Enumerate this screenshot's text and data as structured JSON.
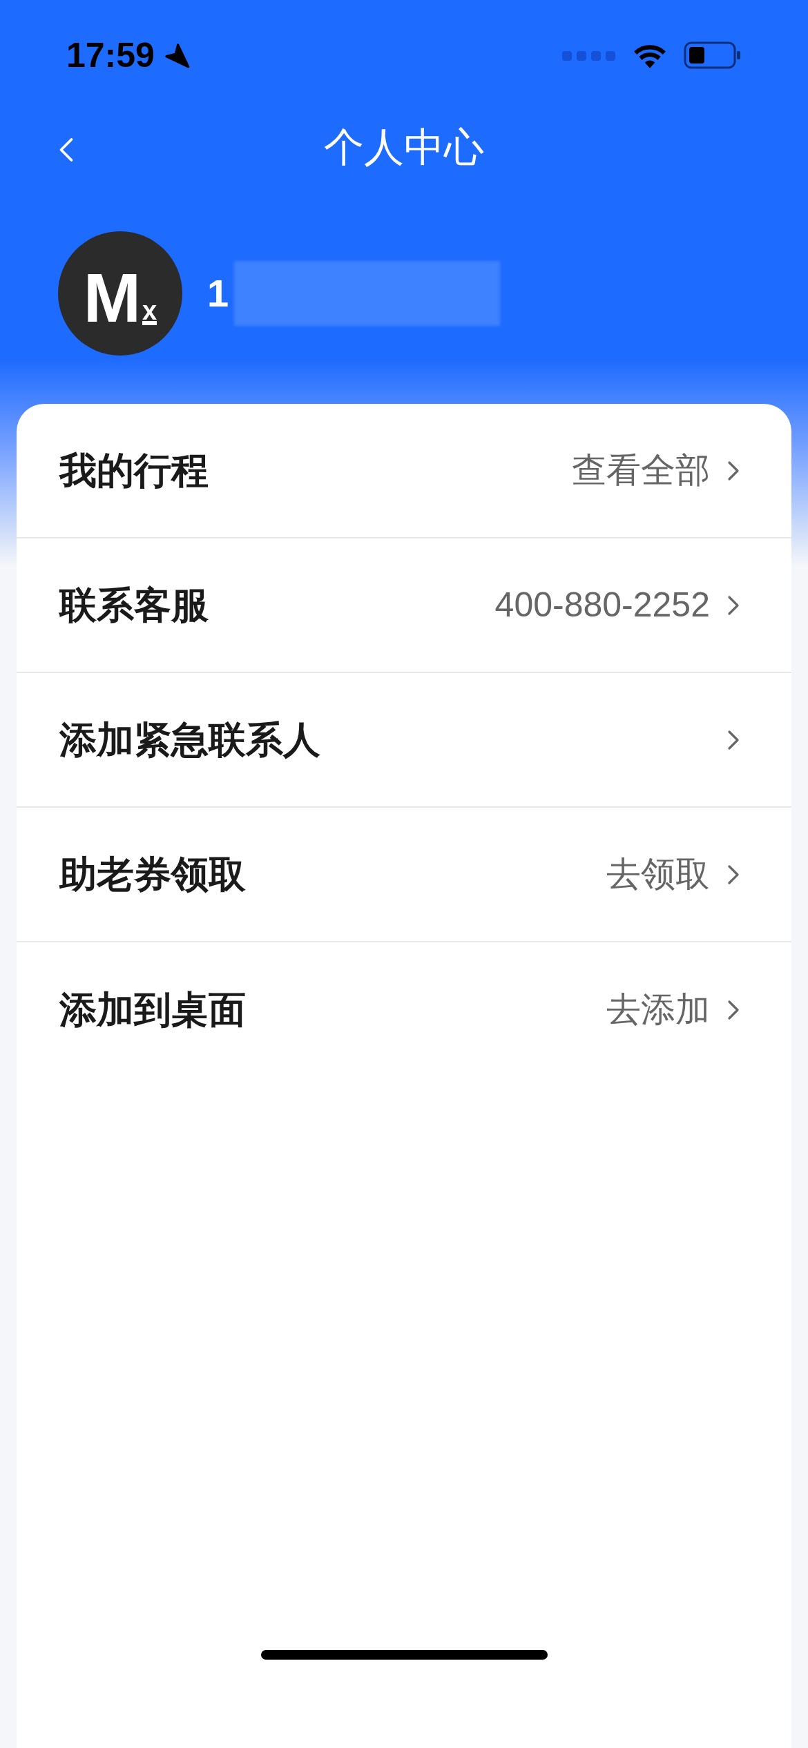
{
  "status_bar": {
    "time": "17:59"
  },
  "header": {
    "title": "个人中心"
  },
  "profile": {
    "avatar": {
      "logo": "M",
      "logo_sub": "x"
    },
    "phone_visible": "1",
    "phone_redacted": true
  },
  "menu": [
    {
      "label": "我的行程",
      "value": "查看全部"
    },
    {
      "label": "联系客服",
      "value": "400-880-2252"
    },
    {
      "label": "添加紧急联系人"
    },
    {
      "label": "助老券领取",
      "value": "去领取"
    },
    {
      "label": "添加到桌面",
      "value": "去添加"
    }
  ]
}
